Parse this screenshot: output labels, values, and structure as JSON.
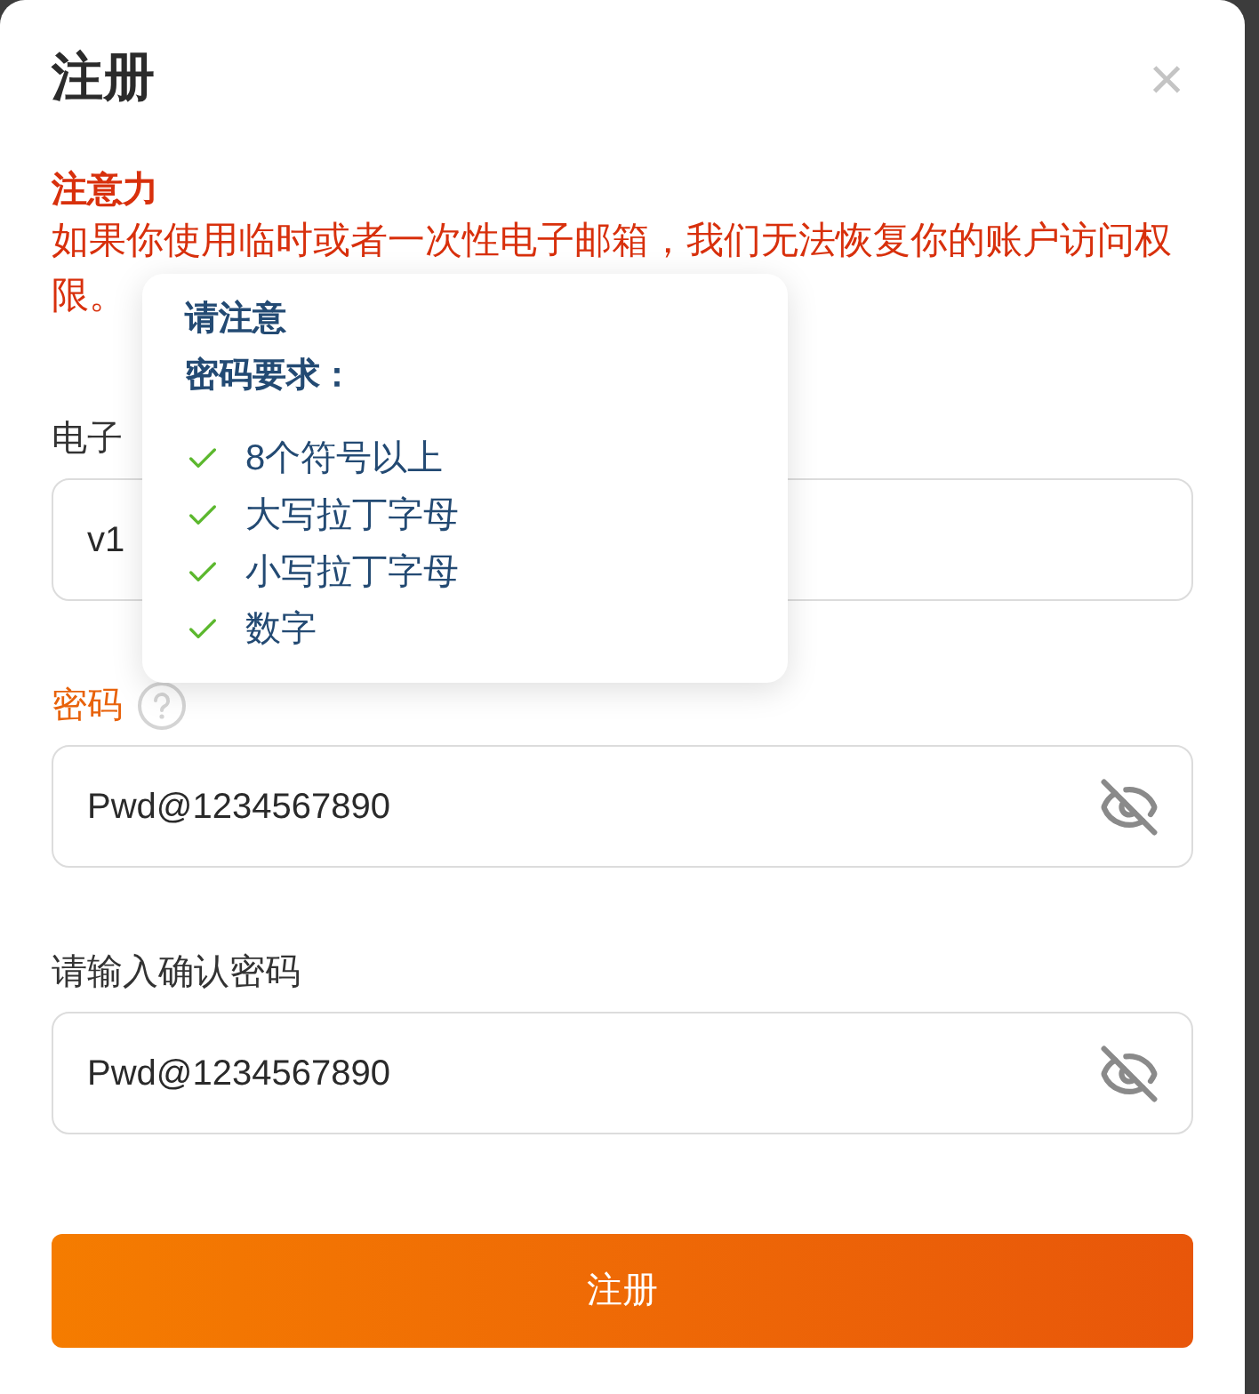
{
  "dialog": {
    "title": "注册",
    "close_label": "×"
  },
  "notice": {
    "title": "注意力",
    "lines": [
      "如果你使用临时或者一次性电子邮箱，我们无法恢复你的账户访问权",
      "限。"
    ]
  },
  "tooltip": {
    "title": "请注意",
    "subtitle": "密码要求：",
    "requirements": [
      {
        "text": "8个符号以上",
        "met": true
      },
      {
        "text": "大写拉丁字母",
        "met": true
      },
      {
        "text": "小写拉丁字母",
        "met": true
      },
      {
        "text": "数字",
        "met": true
      }
    ]
  },
  "fields": [
    {
      "kind": "text",
      "label": "电子",
      "value": "v1",
      "highlighted": false
    },
    {
      "kind": "password",
      "label": "密码",
      "value": "Pwd@1234567890",
      "highlighted": true,
      "help": true,
      "password_shown": true
    },
    {
      "kind": "password",
      "label": "请输入确认密码",
      "value": "Pwd@1234567890",
      "highlighted": false,
      "help": false,
      "password_shown": true
    }
  ],
  "submit": {
    "label": "注册"
  }
}
